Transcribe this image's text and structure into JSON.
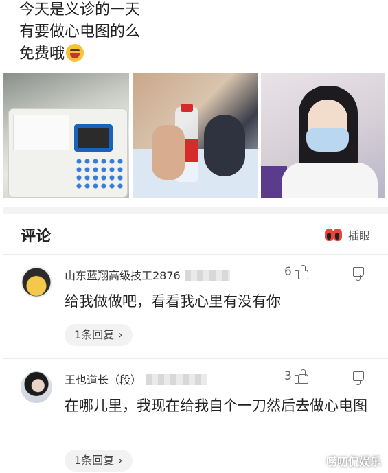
{
  "post": {
    "lines": [
      "今天是义诊的一天",
      "有要做心电图的么",
      "免费哦"
    ],
    "emoji": "laughing-face-emoji"
  },
  "photos": [
    {
      "subject": "ecg-machine-photo"
    },
    {
      "subject": "water-bottle-photo"
    },
    {
      "subject": "masked-woman-selfie"
    }
  ],
  "comments_section": {
    "title": "评论",
    "peek_label": "插眼",
    "peek_icon": "peek-eyes-icon"
  },
  "comments": [
    {
      "username": "山东蓝翔高级技工2876",
      "likes": "6",
      "text": "给我做做吧，看看我心里有没有你",
      "reply_label": "1条回复",
      "reply_chevron": "›"
    },
    {
      "username": "王也道长（段）",
      "likes": "3",
      "text": "在哪儿里，我现在给我自个一刀然后去做心电图",
      "reply_label": "1条回复",
      "reply_chevron": "›"
    }
  ],
  "watermark": "唠叨侃娱乐",
  "colors": {
    "accent_red": "#e8453c",
    "text": "#222222",
    "secondary_text": "#666666",
    "pill_bg": "#f2f2f2"
  }
}
